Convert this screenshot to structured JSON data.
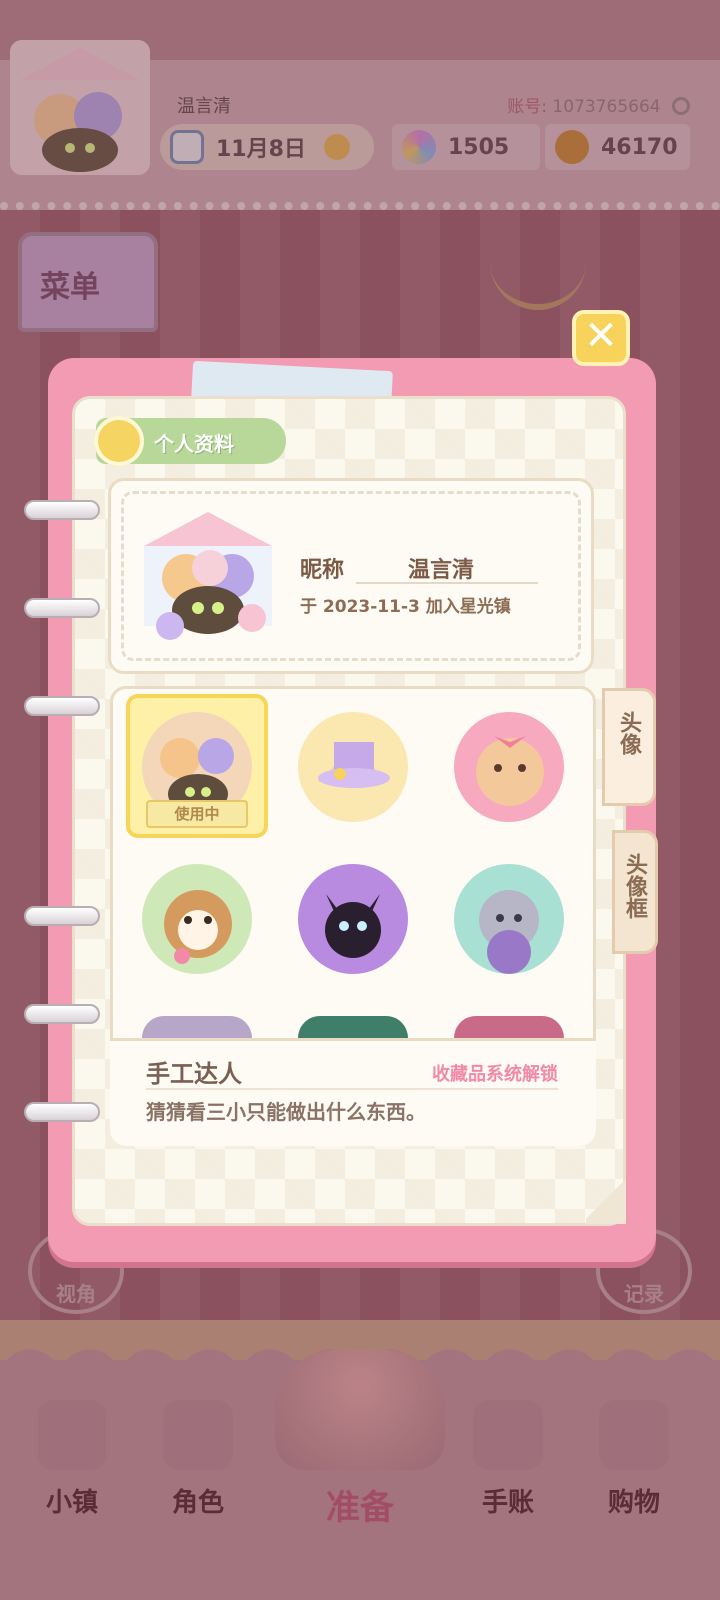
{
  "header": {
    "username": "温言清",
    "account_label": "账号:",
    "account_id": "1073765664",
    "date": "11月8日",
    "flowers": "1505",
    "coins": "46170"
  },
  "menu": {
    "label": "菜单"
  },
  "side_buttons": {
    "view": "视角",
    "record": "记录"
  },
  "modal": {
    "section_title": "个人资料",
    "profile": {
      "nick_label": "昵称",
      "nick_value": "温言清",
      "join_text": "于 2023-11-3 加入星光镇"
    },
    "tabs": [
      "头像",
      "头像框"
    ],
    "using_badge": "使用中",
    "description": {
      "title": "手工达人",
      "unlock": "收藏品系统解锁",
      "body": "猜猜看三小只能做出什么东西。"
    }
  },
  "bottom_nav": {
    "items": [
      "小镇",
      "角色",
      "准备",
      "手账",
      "购物"
    ]
  },
  "colors": {
    "modal_pink": "#f39bb3",
    "paper": "#fbf8ee",
    "accent_yellow": "#f7d35c",
    "unlock_pink": "#f28aa7"
  }
}
